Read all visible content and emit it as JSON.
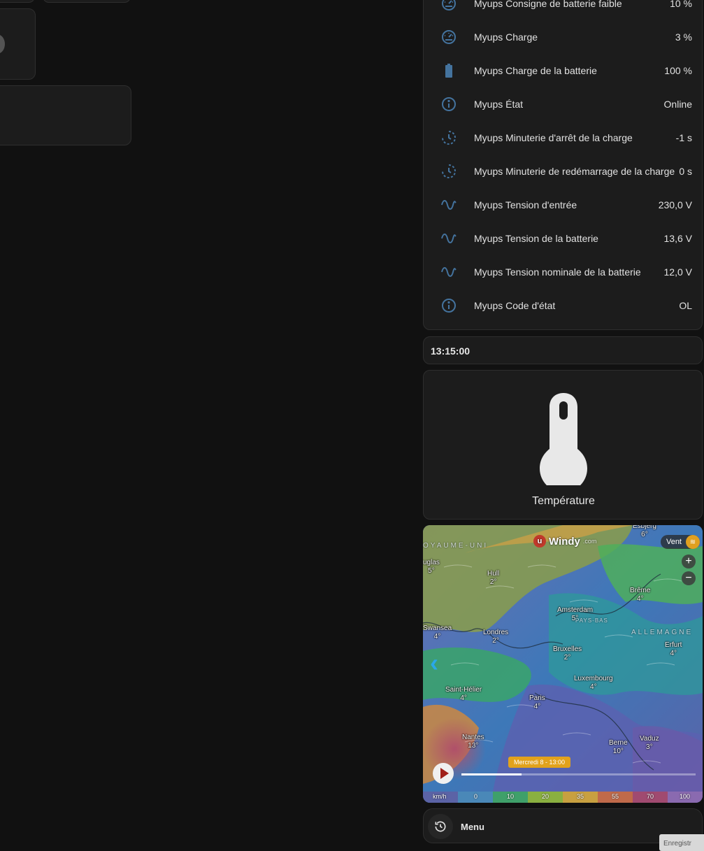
{
  "entities": [
    {
      "icon": "gauge-icon",
      "name": "Myups Consigne de batterie faible",
      "value": "10 %"
    },
    {
      "icon": "gauge-icon",
      "name": "Myups Charge",
      "value": "3 %"
    },
    {
      "icon": "battery-icon",
      "name": "Myups Charge de la batterie",
      "value": "100 %"
    },
    {
      "icon": "info-icon",
      "name": "Myups État",
      "value": "Online"
    },
    {
      "icon": "timer-icon",
      "name": "Myups Minuterie d'arrêt de la charge",
      "value": "-1 s"
    },
    {
      "icon": "timer-icon",
      "name": "Myups Minuterie de redémarrage de la charge",
      "value": "0 s"
    },
    {
      "icon": "sine-wave-icon",
      "name": "Myups Tension d'entrée",
      "value": "230,0 V"
    },
    {
      "icon": "sine-wave-icon",
      "name": "Myups Tension de la batterie",
      "value": "13,6 V"
    },
    {
      "icon": "sine-wave-icon",
      "name": "Myups Tension nominale de la batterie",
      "value": "12,0 V"
    },
    {
      "icon": "info-icon",
      "name": "Myups Code d'état",
      "value": "OL"
    }
  ],
  "clock": {
    "time": "13:15:00"
  },
  "temperature": {
    "icon": "thermometer-icon",
    "label": "Température"
  },
  "windy": {
    "brand": "Windy",
    "brand_suffix": ".com",
    "layer": "Vent",
    "zoom_in": "+",
    "zoom_out": "−",
    "timestamp": "Mercredi 8 - 13:00",
    "countries": [
      "OYAUME-UNI",
      "PAYS-BAS",
      "ALLEMAGNE"
    ],
    "cities": [
      {
        "name": "Esbjerg",
        "temp": "6°"
      },
      {
        "name": "uglas",
        "temp": "5°"
      },
      {
        "name": "Hull",
        "temp": "2°"
      },
      {
        "name": "Brême",
        "temp": "4°"
      },
      {
        "name": "Amsterdam",
        "temp": "5°"
      },
      {
        "name": "Swansea",
        "temp": "4°"
      },
      {
        "name": "Londres",
        "temp": "2°"
      },
      {
        "name": "Bruxelles",
        "temp": "2°"
      },
      {
        "name": "Erfurt",
        "temp": "4°"
      },
      {
        "name": "Luxembourg",
        "temp": "4°"
      },
      {
        "name": "Saint-Hélier",
        "temp": "4°"
      },
      {
        "name": "Paris",
        "temp": "4°"
      },
      {
        "name": "Nantes",
        "temp": "13°"
      },
      {
        "name": "Berne",
        "temp": "10°"
      },
      {
        "name": "Vaduz",
        "temp": "3°"
      }
    ],
    "scale_unit": "km/h",
    "scale_values": [
      "0",
      "10",
      "20",
      "35",
      "55",
      "70",
      "100"
    ]
  },
  "menu": {
    "label": "Menu",
    "icon": "history-icon"
  },
  "corner_text": "Enregistr"
}
